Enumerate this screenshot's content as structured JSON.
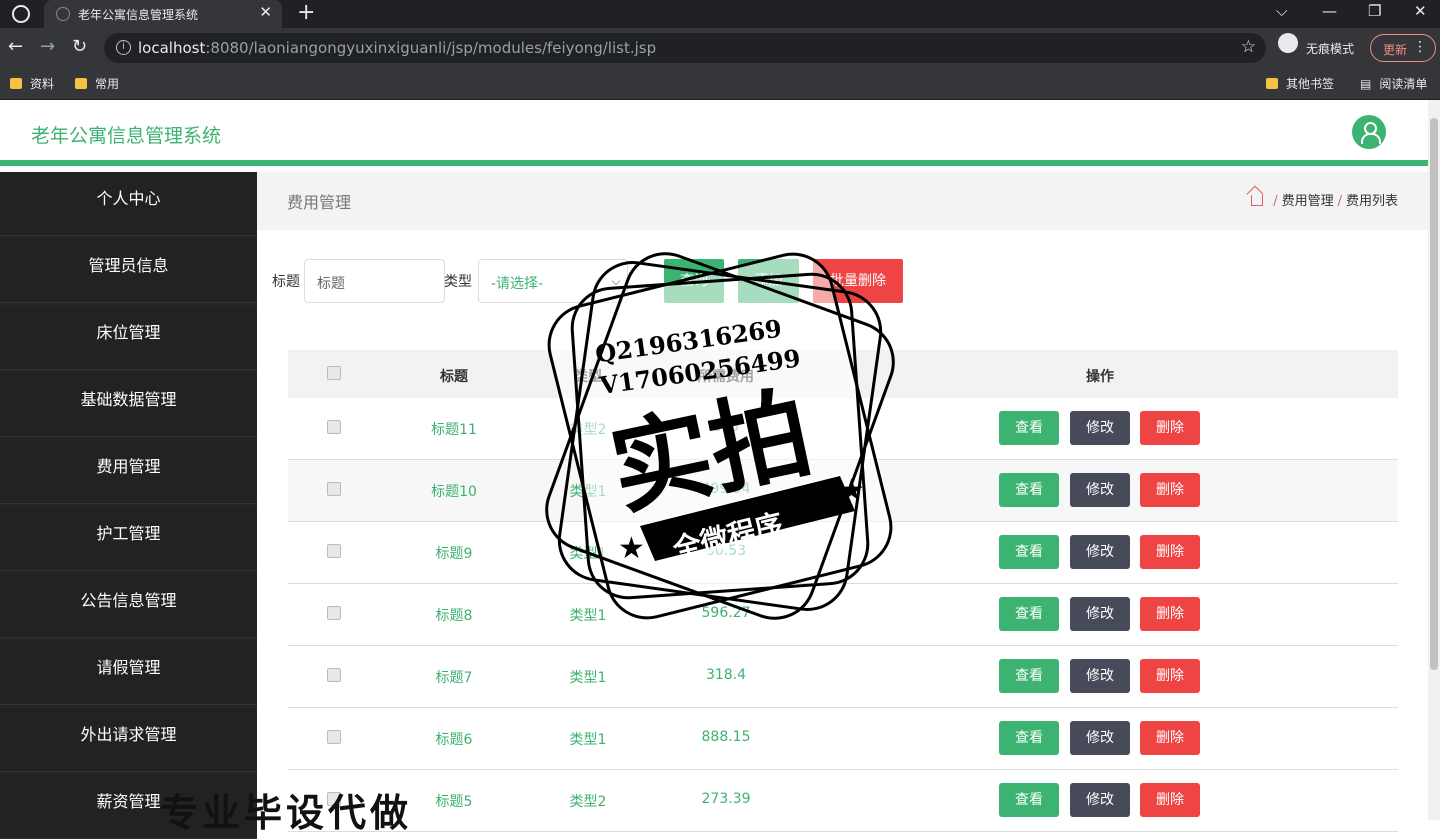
{
  "browser": {
    "tab_title": "老年公寓信息管理系统",
    "tab_close": "✕",
    "new_tab": "+",
    "win_min": "—",
    "win_max": "❐",
    "win_close": "✕",
    "win_dropdown": "⌵",
    "url_host": "localhost",
    "url_rest": ":8080/laoniangongyuxinxiguanli/jsp/modules/feiyong/list.jsp",
    "incognito_label": "无痕模式",
    "update_label": "更新",
    "bookmarks": [
      "资料",
      "常用"
    ],
    "bookmarks_right": [
      "其他书签",
      "阅读清单"
    ]
  },
  "app": {
    "title": "老年公寓信息管理系统"
  },
  "sidebar": {
    "items": [
      {
        "label": "个人中心"
      },
      {
        "label": "管理员信息"
      },
      {
        "label": "床位管理"
      },
      {
        "label": "基础数据管理"
      },
      {
        "label": "费用管理"
      },
      {
        "label": "护工管理"
      },
      {
        "label": "公告信息管理"
      },
      {
        "label": "请假管理"
      },
      {
        "label": "外出请求管理"
      },
      {
        "label": "薪资管理"
      }
    ]
  },
  "breadcrumb": {
    "title": "费用管理",
    "path": [
      "费用管理",
      "费用列表"
    ]
  },
  "search": {
    "title_label": "标题",
    "title_placeholder": "标题",
    "type_label": "类型",
    "type_selected": "-请选择-",
    "query_button": "查询",
    "add_button": "添加",
    "batch_delete_button": "批量删除"
  },
  "table": {
    "headers": [
      "标题",
      "类型",
      "所需费用",
      "操作"
    ],
    "rows": [
      {
        "title": "标题11",
        "type": "类型2",
        "fee": "895"
      },
      {
        "title": "标题10",
        "type": "类型1",
        "fee": "499.94"
      },
      {
        "title": "标题9",
        "type": "类型1",
        "fee": "50.53"
      },
      {
        "title": "标题8",
        "type": "类型1",
        "fee": "596.27"
      },
      {
        "title": "标题7",
        "type": "类型1",
        "fee": "318.4"
      },
      {
        "title": "标题6",
        "type": "类型1",
        "fee": "888.15"
      },
      {
        "title": "标题5",
        "type": "类型2",
        "fee": "273.39"
      }
    ],
    "actions": {
      "view": "查看",
      "edit": "修改",
      "delete": "删除"
    }
  },
  "watermark": {
    "qq": "Q2196316269",
    "vx": "V17060256499",
    "main": "实拍",
    "ribbon": "全微程序",
    "bottom": "专业毕设代做"
  },
  "colors": {
    "accent": "#3cb371",
    "danger": "#ee4444",
    "edit": "#464a59",
    "sidebar": "#222222"
  }
}
